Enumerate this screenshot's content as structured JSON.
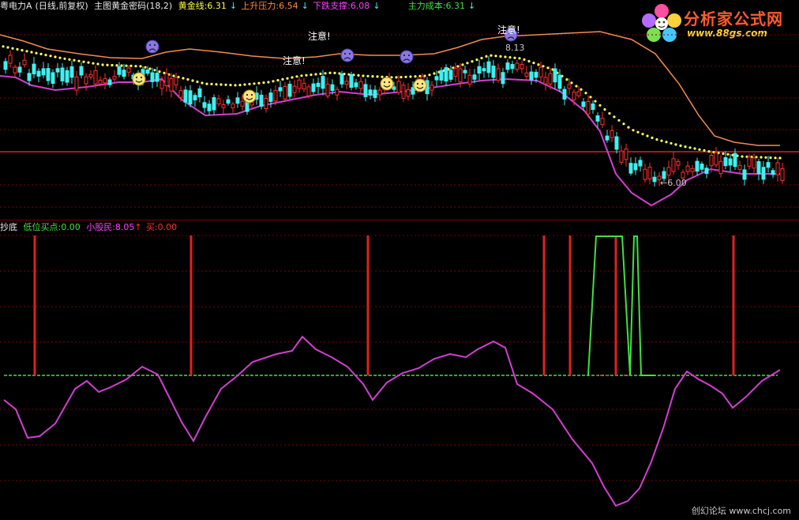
{
  "top_legend": {
    "stock": "粤电力A",
    "period": "(日线,前复权)",
    "indicator": "主图黄金密码(18,2)",
    "items": [
      {
        "label": "黄金线:6.31",
        "color": "#ffff40",
        "arrow": "↓"
      },
      {
        "label": "上升压力:6.54",
        "color": "#ff8c3c",
        "arrow": "↓"
      },
      {
        "label": "下跌支撑:6.08",
        "color": "#ff40ff",
        "arrow": "↓"
      },
      {
        "label": "主力成本:6.31",
        "color": "#40e040",
        "arrow": "↓"
      }
    ]
  },
  "annotations": {
    "attention": "注意!",
    "high_price": "8.13",
    "low_price": "←6.00"
  },
  "bottom_legend": {
    "name": "抄底",
    "items": [
      {
        "label": "低位买点:0.00",
        "color": "#40e040"
      },
      {
        "label": "小股民:8.05",
        "color": "#ff40ff",
        "arrow": "↑"
      },
      {
        "label": "买:0.00",
        "color": "#ff3030"
      }
    ]
  },
  "logo": {
    "title": "分析家公式网",
    "url": "www.88gs.com"
  },
  "watermark": "创幻论坛 www.chcj.com",
  "colors": {
    "upper": "#f08c50",
    "lower": "#d040d0",
    "dots": "#ffff60",
    "up_candle": "#ff3030",
    "down_candle": "#40f0f0",
    "redline": "#e02020",
    "grid": "#7a0000"
  }
}
